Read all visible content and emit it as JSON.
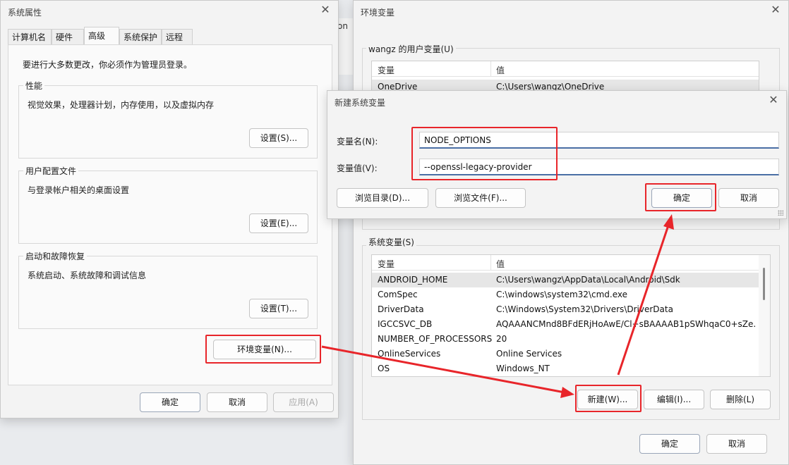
{
  "sys_props": {
    "title": "系统属性",
    "tabs": [
      "计算机名",
      "硬件",
      "高级",
      "系统保护",
      "远程"
    ],
    "admin_note": "要进行大多数更改，你必须作为管理员登录。",
    "groups": {
      "performance": {
        "label": "性能",
        "desc": "视觉效果，处理器计划，内存使用，以及虚拟内存",
        "button": "设置(S)..."
      },
      "profiles": {
        "label": "用户配置文件",
        "desc": "与登录帐户相关的桌面设置",
        "button": "设置(E)..."
      },
      "startup": {
        "label": "启动和故障恢复",
        "desc": "系统启动、系统故障和调试信息",
        "button": "设置(T)..."
      }
    },
    "env_button": "环境变量(N)...",
    "ok": "确定",
    "cancel": "取消",
    "apply": "应用(A)"
  },
  "behind_fragment": "on",
  "env_vars": {
    "title": "环境变量",
    "user_section": "wangz 的用户变量(U)",
    "col_var": "变量",
    "col_val": "值",
    "user_rows": [
      {
        "name": "OneDrive",
        "value": "C:\\Users\\wangz\\OneDrive"
      }
    ],
    "system_section": "系统变量(S)",
    "system_rows": [
      {
        "name": "ANDROID_HOME",
        "value": "C:\\Users\\wangz\\AppData\\Local\\Android\\Sdk"
      },
      {
        "name": "ComSpec",
        "value": "C:\\windows\\system32\\cmd.exe"
      },
      {
        "name": "DriverData",
        "value": "C:\\Windows\\System32\\Drivers\\DriverData"
      },
      {
        "name": "IGCCSVC_DB",
        "value": "AQAAANCMnd8BFdERjHoAwE/Cl+sBAAAAB1pSWhqaC0+sZe..."
      },
      {
        "name": "NUMBER_OF_PROCESSORS",
        "value": "20"
      },
      {
        "name": "OnlineServices",
        "value": "Online Services"
      },
      {
        "name": "OS",
        "value": "Windows_NT"
      }
    ],
    "new_btn": "新建(W)...",
    "edit_btn": "编辑(I)...",
    "delete_btn": "删除(L)",
    "ok": "确定",
    "cancel": "取消"
  },
  "new_var": {
    "title": "新建系统变量",
    "name_label": "变量名(N):",
    "value_label": "变量值(V):",
    "name_value": "NODE_OPTIONS",
    "value_value": "--openssl-legacy-provider",
    "browse_dir": "浏览目录(D)...",
    "browse_file": "浏览文件(F)...",
    "ok": "确定",
    "cancel": "取消"
  },
  "colors": {
    "highlight": "#e8252a",
    "accent": "#4a6fa5"
  }
}
